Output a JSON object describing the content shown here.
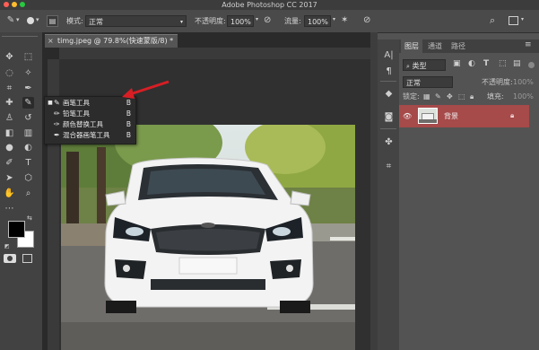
{
  "app": {
    "title": "Adobe Photoshop CC 2017"
  },
  "options_bar": {
    "mode_label": "模式:",
    "mode_value": "正常",
    "opacity_label": "不透明度:",
    "opacity_value": "100%",
    "flow_label": "流量:",
    "flow_value": "100%"
  },
  "document": {
    "tab_title": "timg.jpeg @ 79.8%(快速蒙版/8) *",
    "close_icon": "×"
  },
  "brush_flyout": {
    "items": [
      {
        "label": "画笔工具",
        "key": "B",
        "selected": true
      },
      {
        "label": "铅笔工具",
        "key": "B",
        "selected": false
      },
      {
        "label": "颜色替换工具",
        "key": "B",
        "selected": false
      },
      {
        "label": "混合器画笔工具",
        "key": "B",
        "selected": false
      }
    ]
  },
  "layers_panel": {
    "tabs": [
      "图层",
      "通道",
      "路径"
    ],
    "kind_label": "类型",
    "blend_mode": "正常",
    "opacity_label": "不透明度:",
    "opacity_value": "100%",
    "lock_label": "锁定:",
    "fill_label": "填充:",
    "fill_value": "100%",
    "layer": {
      "name": "背景"
    }
  },
  "colors": {
    "highlight_layer": "#a64a4a",
    "arrow": "#d71e25",
    "foreground": "#000000",
    "background": "#ffffff"
  }
}
